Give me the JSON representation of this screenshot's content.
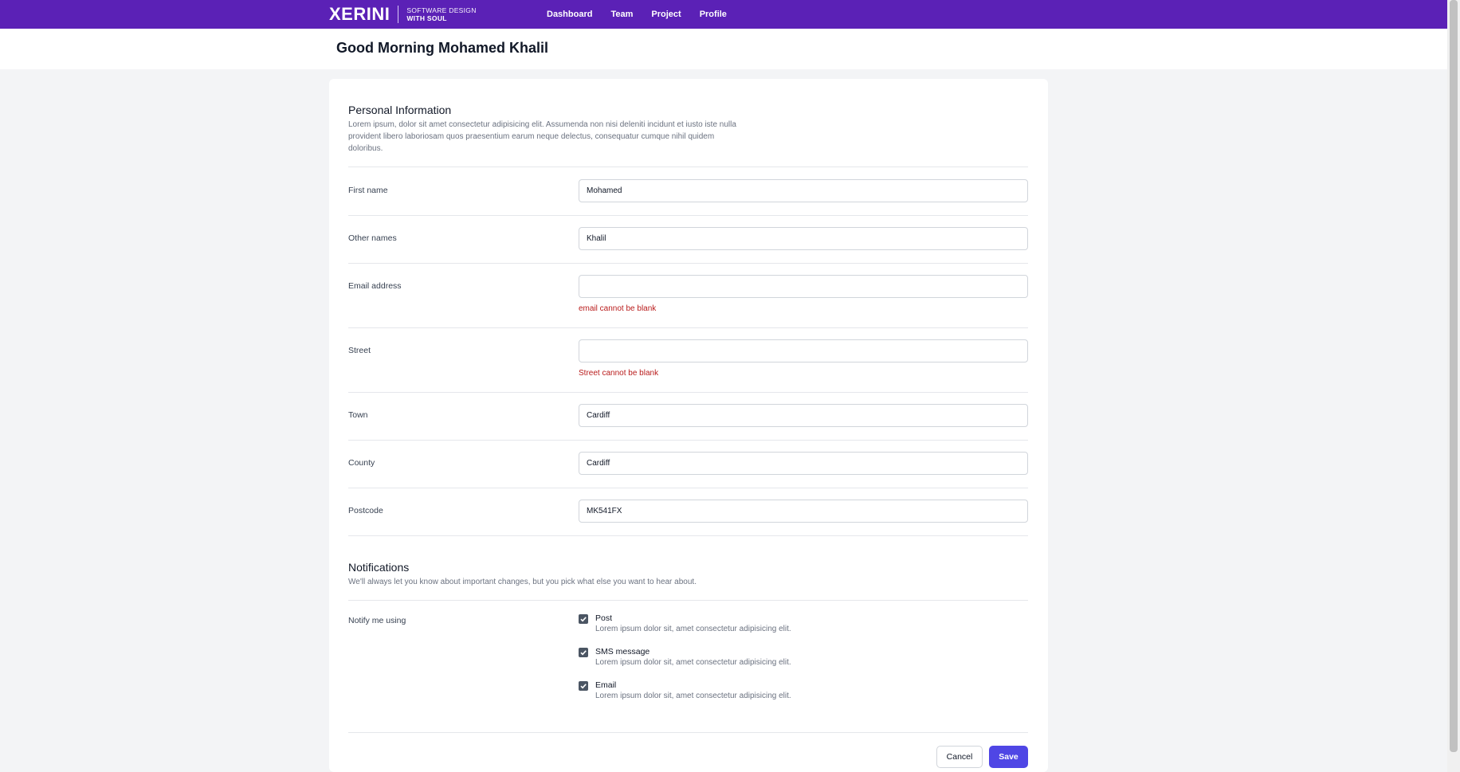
{
  "brand": {
    "logo_text": "XERINI",
    "tagline_top": "SOFTWARE DESIGN",
    "tagline_bottom": "WITH SOUL",
    "color": "#5b21b6"
  },
  "nav": {
    "items": [
      {
        "label": "Dashboard"
      },
      {
        "label": "Team"
      },
      {
        "label": "Project"
      },
      {
        "label": "Profile"
      }
    ]
  },
  "header": {
    "greeting": "Good Morning Mohamed Khalil"
  },
  "personal": {
    "title": "Personal Information",
    "description": "Lorem ipsum, dolor sit amet consectetur adipisicing elit. Assumenda non nisi deleniti incidunt et iusto iste nulla provident libero laboriosam quos praesentium earum neque delectus, consequatur cumque nihil quidem doloribus.",
    "fields": {
      "first_name": {
        "label": "First name",
        "value": "Mohamed"
      },
      "other_names": {
        "label": "Other names",
        "value": "Khalil"
      },
      "email": {
        "label": "Email address",
        "value": "",
        "error": "email cannot be blank"
      },
      "street": {
        "label": "Street",
        "value": "",
        "error": "Street cannot be blank"
      },
      "town": {
        "label": "Town",
        "value": "Cardiff"
      },
      "county": {
        "label": "County",
        "value": "Cardiff"
      },
      "postcode": {
        "label": "Postcode",
        "value": "MK541FX"
      }
    }
  },
  "notifications": {
    "title": "Notifications",
    "description": "We'll always let you know about important changes, but you pick what else you want to hear about.",
    "label": "Notify me using",
    "options": [
      {
        "label": "Post",
        "description": "Lorem ipsum dolor sit, amet consectetur adipisicing elit.",
        "checked": true
      },
      {
        "label": "SMS message",
        "description": "Lorem ipsum dolor sit, amet consectetur adipisicing elit.",
        "checked": true
      },
      {
        "label": "Email",
        "description": "Lorem ipsum dolor sit, amet consectetur adipisicing elit.",
        "checked": true
      }
    ]
  },
  "actions": {
    "cancel_label": "Cancel",
    "save_label": "Save",
    "save_color": "#4f46e5"
  }
}
